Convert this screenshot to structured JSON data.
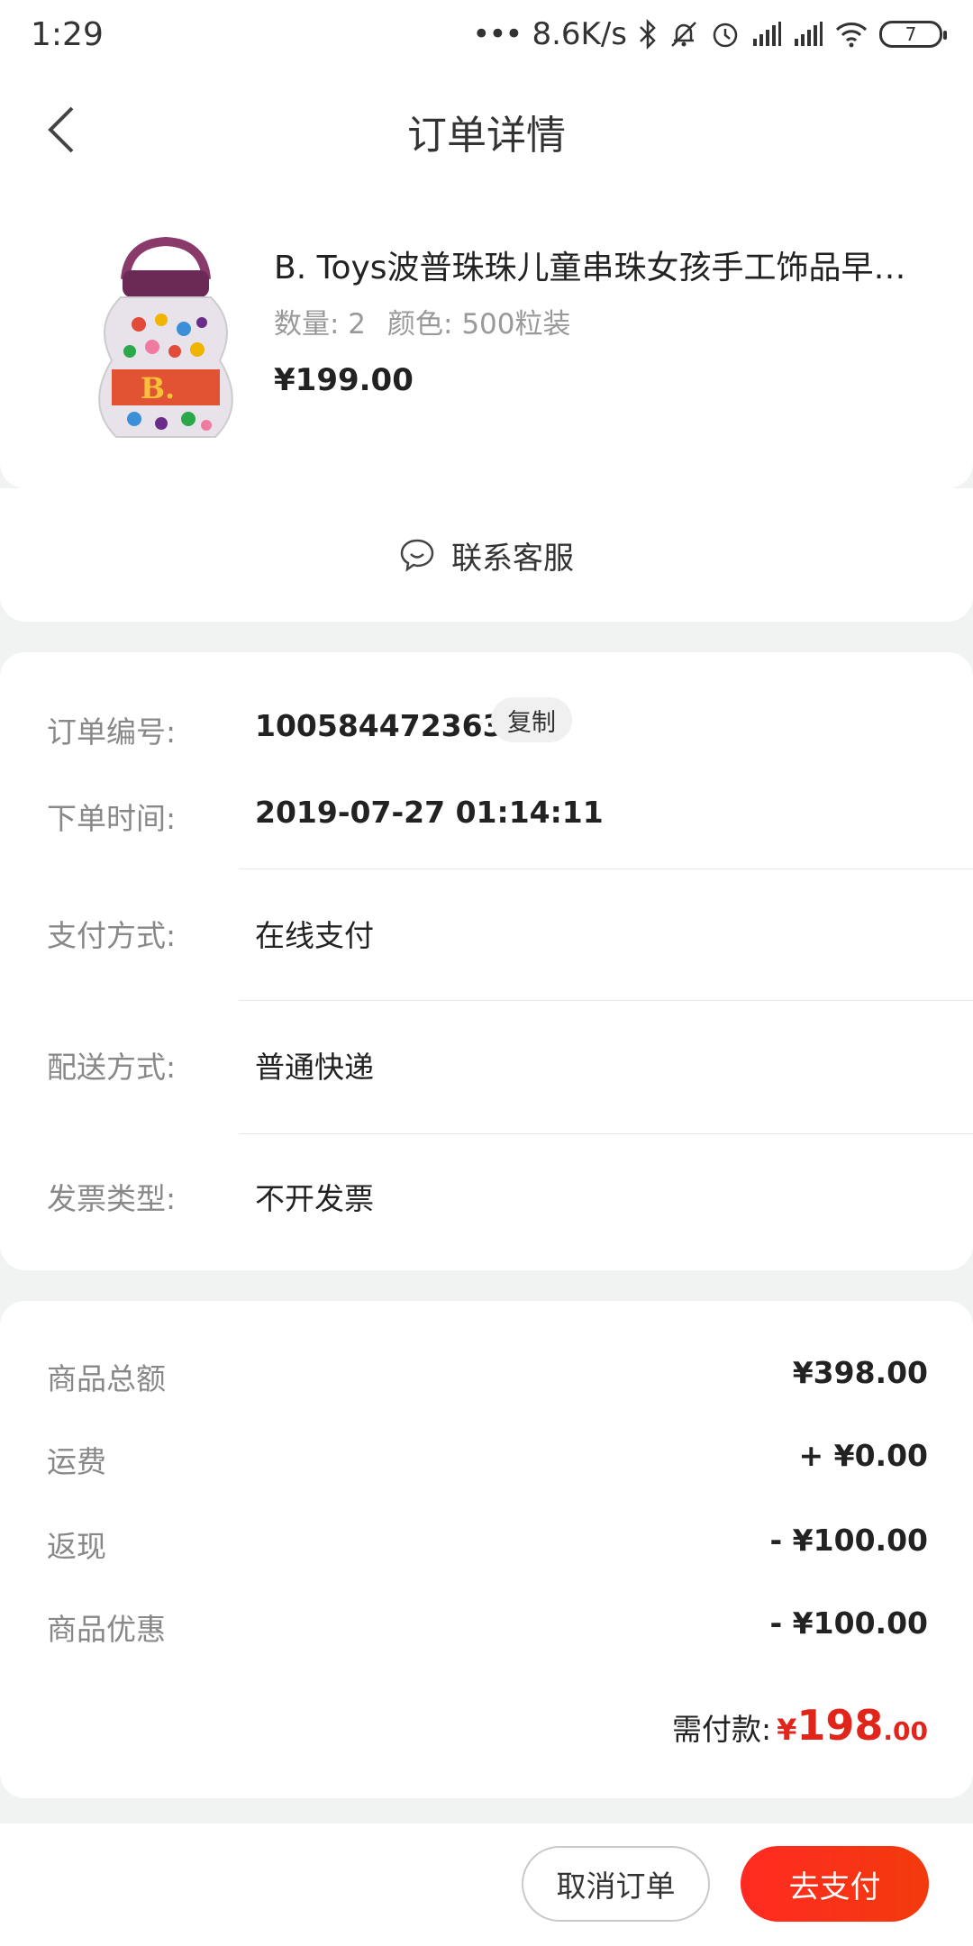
{
  "status_bar": {
    "time": "1:29",
    "network_speed": "8.6K/s",
    "battery": "7"
  },
  "header": {
    "title": "订单详情"
  },
  "product": {
    "title": "B. Toys波普珠珠儿童串珠女孩手工饰品早教...",
    "quantity": "数量: 2",
    "color": "颜色: 500粒装",
    "price": "¥199.00",
    "image_icon": "bead-jar-image"
  },
  "service": {
    "label": "联系客服",
    "icon": "chat-icon"
  },
  "order_info": {
    "order_no_label": "订单编号:",
    "order_no": "100584472363",
    "copy_label": "复制",
    "time_label": "下单时间:",
    "time": "2019-07-27 01:14:11",
    "payment_label": "支付方式:",
    "payment": "在线支付",
    "delivery_label": "配送方式:",
    "delivery": "普通快递",
    "invoice_label": "发票类型:",
    "invoice": "不开发票"
  },
  "amounts": {
    "items_total_label": "商品总额",
    "items_total": "¥398.00",
    "shipping_label": "运费",
    "shipping": "+ ¥0.00",
    "cashback_label": "返现",
    "cashback": "- ¥100.00",
    "discount_label": "商品优惠",
    "discount": "- ¥100.00",
    "payable_label": "需付款:",
    "payable_currency": "¥",
    "payable_int": "198",
    "payable_dec": ".00"
  },
  "actions": {
    "cancel": "取消订单",
    "pay": "去支付"
  },
  "colors": {
    "accent": "#e1251b",
    "background": "#f1f2f2"
  }
}
